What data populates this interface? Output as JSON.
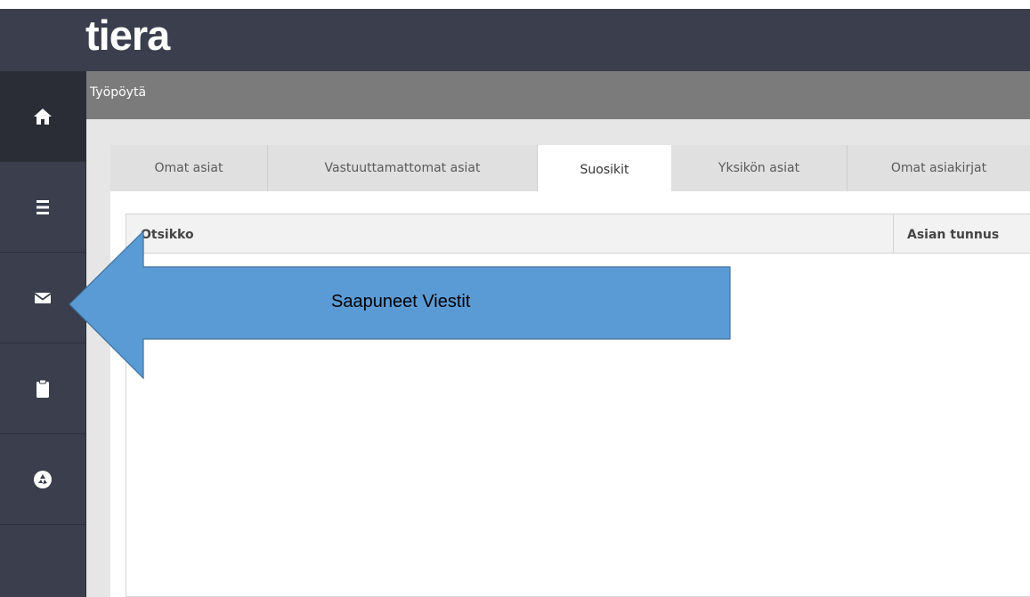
{
  "app": {
    "logo": "tiera"
  },
  "breadcrumb": {
    "title": "Työpöytä"
  },
  "sidebar": {
    "items": [
      {
        "icon": "home-icon"
      },
      {
        "icon": "menu-icon"
      },
      {
        "icon": "mail-icon"
      },
      {
        "icon": "clipboard-icon"
      },
      {
        "icon": "recycle-icon"
      }
    ]
  },
  "tabs": [
    {
      "label": "Omat asiat"
    },
    {
      "label": "Vastuuttamattomat asiat"
    },
    {
      "label": "Suosikit",
      "active": true
    },
    {
      "label": "Yksikön asiat"
    },
    {
      "label": "Omat asiakirjat"
    }
  ],
  "table": {
    "columns": [
      "Otsikko",
      "Asian tunnus"
    ]
  },
  "callout": {
    "text": "Saapuneet Viestit",
    "color": "#5b9bd5"
  }
}
